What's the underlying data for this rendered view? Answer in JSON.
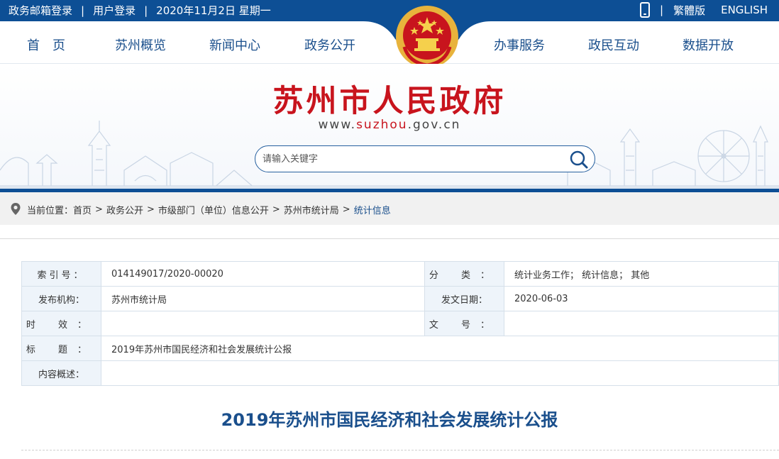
{
  "topbar": {
    "email_login": "政务邮箱登录",
    "user_login": "用户登录",
    "date": "2020年11月2日 星期一",
    "separator": "|",
    "traditional": "繁體版",
    "english": "ENGLISH",
    "phone_icon": "mobile-phone-icon"
  },
  "nav": {
    "home": "首页",
    "overview": "苏州概览",
    "news": "新闻中心",
    "gov_affairs": "政务公开",
    "services": "办事服务",
    "interaction": "政民互动",
    "open_data": "数据开放"
  },
  "banner": {
    "title": "苏州市人民政府",
    "url_prefix": "www.",
    "url_highlight": "suzhou",
    "url_suffix": ".gov.cn",
    "search_placeholder": "请输入关键字",
    "emblem_icon": "national-emblem-icon",
    "search_icon": "magnifier-icon"
  },
  "breadcrumb": {
    "label": "当前位置：",
    "items": [
      "首页",
      "政务公开",
      "市级部门（单位）信息公开",
      "苏州市统计局"
    ],
    "current": "统计信息",
    "separator": ">",
    "location_icon": "map-pin-icon"
  },
  "meta": {
    "index_no_label": "索引号：",
    "index_no": "014149017/2020-00020",
    "category_label": "分 类：",
    "category": "统计业务工作； 统计信息； 其他",
    "publisher_label": "发布机构：",
    "publisher": "苏州市统计局",
    "date_label": "发文日期：",
    "date": "2020-06-03",
    "validity_label": "时 效：",
    "validity": "",
    "doc_no_label": "文 号：",
    "doc_no": "",
    "title_label": "标 题：",
    "title": "2019年苏州市国民经济和社会发展统计公报",
    "summary_label": "内容概述：",
    "summary": ""
  },
  "article": {
    "title": "2019年苏州市国民经济和社会发展统计公报"
  },
  "colors": {
    "primary_blue": "#0d4f95",
    "title_red": "#c8141d",
    "link_blue": "#1a4f8c"
  }
}
